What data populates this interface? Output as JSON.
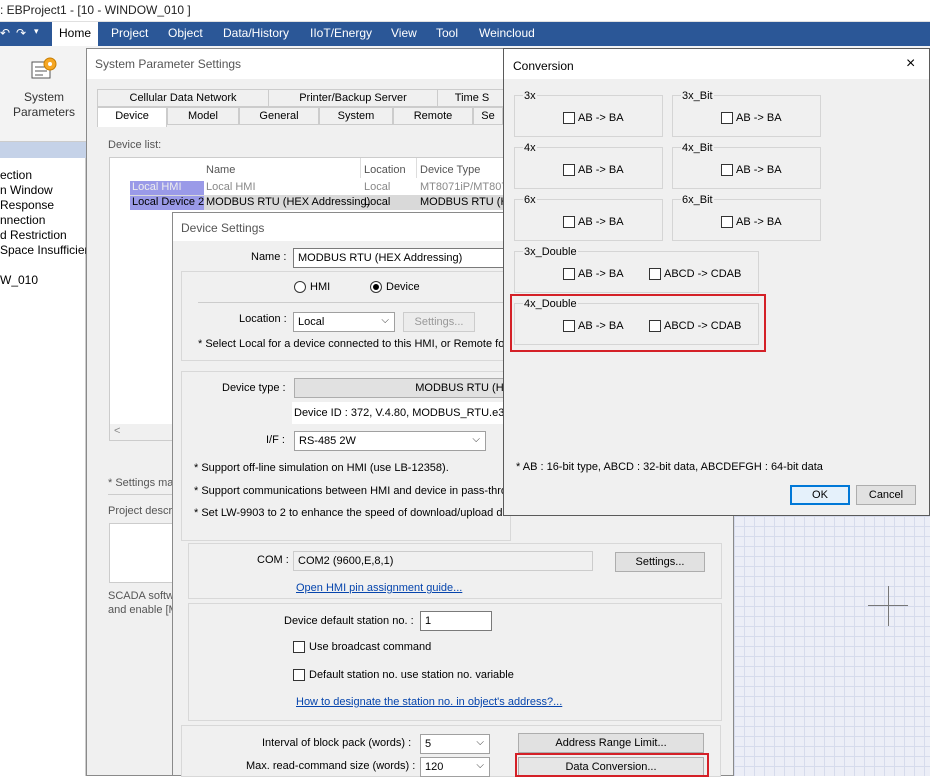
{
  "app": {
    "title": ": EBProject1 - [10 - WINDOW_010 ]",
    "ribbon_tabs": [
      "Home",
      "Project",
      "Object",
      "Data/History",
      "IIoT/Energy",
      "View",
      "Tool",
      "Weincloud"
    ],
    "ribbon_button_line1": "System",
    "ribbon_button_line2": "Parameters"
  },
  "sidebar": {
    "items": [
      "ection",
      "n Window",
      "Response",
      "nnection",
      "d Restriction",
      "Space Insufficier",
      "",
      "W_010"
    ]
  },
  "system_params": {
    "title": "System Parameter Settings",
    "tabs_row1": [
      "Cellular Data Network",
      "Printer/Backup Server",
      "Time S"
    ],
    "tabs_row2": [
      "Device",
      "Model",
      "General",
      "System",
      "Remote",
      "Se"
    ],
    "device_list_label": "Device list:",
    "columns": [
      "Name",
      "Location",
      "Device Type"
    ],
    "rows": [
      {
        "id": "Local HMI",
        "name": "Local HMI",
        "location": "Local",
        "type": "MT8071iP/MT807"
      },
      {
        "id": "Local Device 2",
        "name": "MODBUS RTU (HEX Addressing)",
        "location": "Local",
        "type": "MODBUS RTU (HE"
      }
    ],
    "scroll_left": "<",
    "settings_note": "* Settings ma",
    "project_desc_label": "Project descri",
    "scada_line1": "SCADA softwa",
    "scada_line2": "and enable [M"
  },
  "device_settings": {
    "title": "Device Settings",
    "name_label": "Name :",
    "name_value": "MODBUS RTU (HEX Addressing)",
    "radio_hmi": "HMI",
    "radio_device": "Device",
    "location_label": "Location :",
    "location_value": "Local",
    "location_settings": "Settings...",
    "location_note": "* Select Local for a device connected to this HMI, or Remote for",
    "device_type_label": "Device type :",
    "device_type_value": "MODBUS RTU (HE",
    "device_id": "Device ID : 372, V.4.80, MODBUS_RTU.e30",
    "if_label": "I/F :",
    "if_value": "RS-485 2W",
    "note1": "* Support off-line simulation on HMI (use LB-12358).",
    "note2": "* Support communications between HMI and device in pass-throu",
    "note3": "* Set LW-9903 to 2 to enhance the speed of download/upload d",
    "com_label": "COM :",
    "com_value": "COM2 (9600,E,8,1)",
    "com_settings": "Settings...",
    "pin_guide_link": "Open HMI pin assignment guide...",
    "station_label": "Device default station no. :",
    "station_value": "1",
    "broadcast": "Use broadcast command",
    "station_var": "Default station no. use station no. variable",
    "station_link": "How to designate the station no. in object's address?...",
    "block_pack_label": "Interval of block pack (words) :",
    "block_pack_value": "5",
    "read_size_label": "Max. read-command size (words) :",
    "read_size_value": "120",
    "address_range_btn": "Address Range Limit...",
    "data_conversion_btn": "Data Conversion..."
  },
  "conversion": {
    "title": "Conversion",
    "close": "×",
    "groups": [
      {
        "label": "3x",
        "options": [
          "AB -> BA"
        ]
      },
      {
        "label": "3x_Bit",
        "options": [
          "AB -> BA"
        ]
      },
      {
        "label": "4x",
        "options": [
          "AB -> BA"
        ]
      },
      {
        "label": "4x_Bit",
        "options": [
          "AB -> BA"
        ]
      },
      {
        "label": "6x",
        "options": [
          "AB -> BA"
        ]
      },
      {
        "label": "6x_Bit",
        "options": [
          "AB -> BA"
        ]
      },
      {
        "label": "3x_Double",
        "options": [
          "AB -> BA",
          "ABCD -> CDAB"
        ]
      },
      {
        "label": "4x_Double",
        "options": [
          "AB -> BA",
          "ABCD -> CDAB"
        ]
      }
    ],
    "footnote": "* AB : 16-bit type, ABCD : 32-bit data, ABCDEFGH : 64-bit data",
    "ok": "OK",
    "cancel": "Cancel"
  },
  "colors": {
    "ribbon_blue": "#2b5797",
    "highlight_red": "#d42027",
    "selection_blue": "#9a9ae8",
    "link_blue": "#0645ad"
  }
}
